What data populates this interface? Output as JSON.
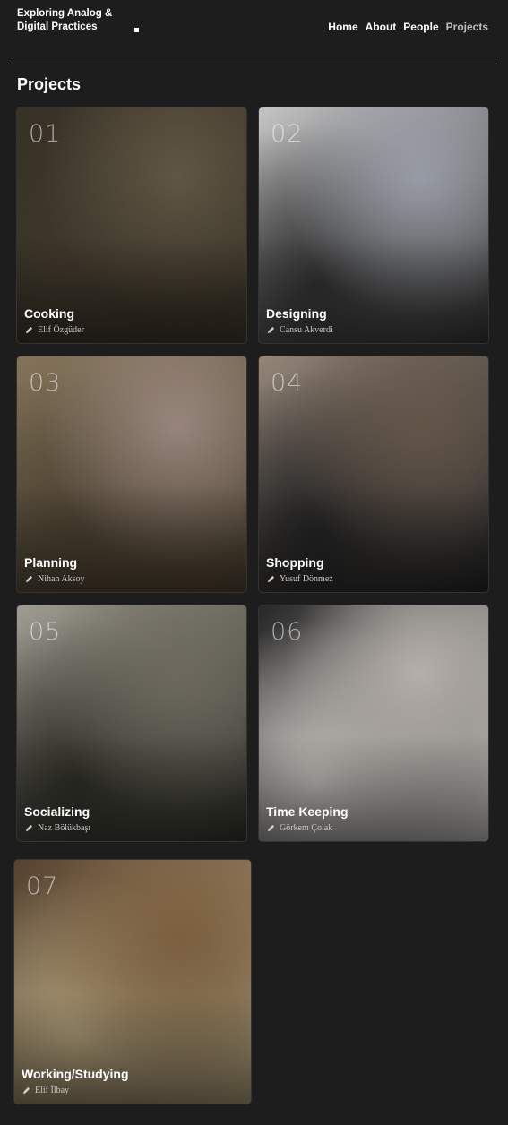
{
  "site": {
    "title_line1": "Exploring Analog &",
    "title_line2": "Digital Practices"
  },
  "nav": {
    "items": [
      {
        "label": "Home",
        "active": false
      },
      {
        "label": "About",
        "active": false
      },
      {
        "label": "People",
        "active": false
      },
      {
        "label": "Projects",
        "active": true
      }
    ]
  },
  "page": {
    "title": "Projects"
  },
  "projects": [
    {
      "number": "01",
      "title": "Cooking",
      "author": "Elif Özgüder",
      "icon": "pen-icon",
      "palette": [
        "#3b3428",
        "#6b604b",
        "#4a4233"
      ]
    },
    {
      "number": "02",
      "title": "Designing",
      "author": "Cansu Akverdi",
      "icon": "pen-icon",
      "palette": [
        "#cfcfcf",
        "#a9adb8",
        "#3c3c3c"
      ]
    },
    {
      "number": "03",
      "title": "Planning",
      "author": "Nihan Aksoy",
      "icon": "pen-icon",
      "palette": [
        "#8a7a5e",
        "#a8948a",
        "#5c4f3c"
      ]
    },
    {
      "number": "04",
      "title": "Shopping",
      "author": "Yusuf Dönmez",
      "icon": "pen-icon",
      "palette": [
        "#9c8c7e",
        "#6e5e50",
        "#2b2b2b"
      ]
    },
    {
      "number": "05",
      "title": "Socializing",
      "author": "Naz Bölükbaşı",
      "icon": "pen-icon",
      "palette": [
        "#a8a49a",
        "#787468",
        "#3a3a30"
      ]
    },
    {
      "number": "06",
      "title": "Time Keeping",
      "author": "Görkem Çolak",
      "icon": "pen-icon",
      "palette": [
        "#2a2a2a",
        "#c9c3bd",
        "#e6e1dc"
      ]
    },
    {
      "number": "07",
      "title": "Working/Studying",
      "author": "Elif İlbay",
      "icon": "pen-icon",
      "palette": [
        "#5b4632",
        "#8a6b46",
        "#c8b48a"
      ]
    }
  ]
}
